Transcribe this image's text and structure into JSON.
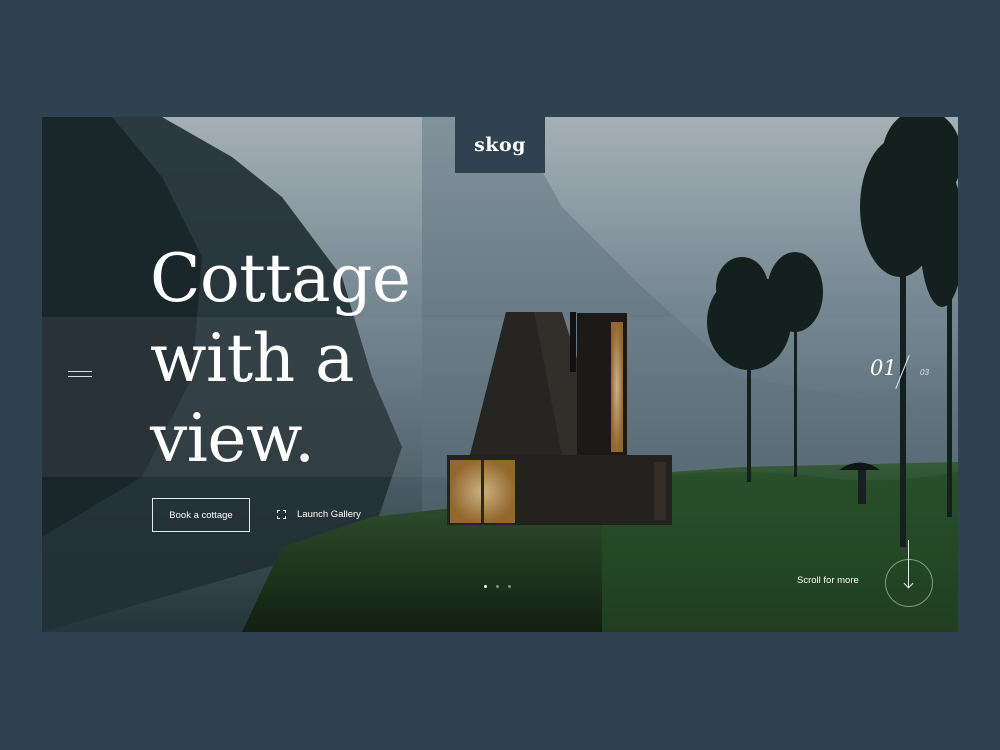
{
  "brand": {
    "logo_text": "skog",
    "page_background": "#2f4250"
  },
  "hero": {
    "headline_lines": [
      "Cottage",
      "with a",
      "view."
    ],
    "primary_button": "Book a cottage",
    "secondary_link": "Launch Gallery",
    "secondary_icon": "expand-icon",
    "menu_icon": "hamburger-icon"
  },
  "slider": {
    "current": "01",
    "total": "03",
    "dots": [
      {
        "active": true
      },
      {
        "active": false
      },
      {
        "active": false
      }
    ]
  },
  "scroll": {
    "label": "Scroll for more",
    "icon": "arrow-down-icon"
  }
}
